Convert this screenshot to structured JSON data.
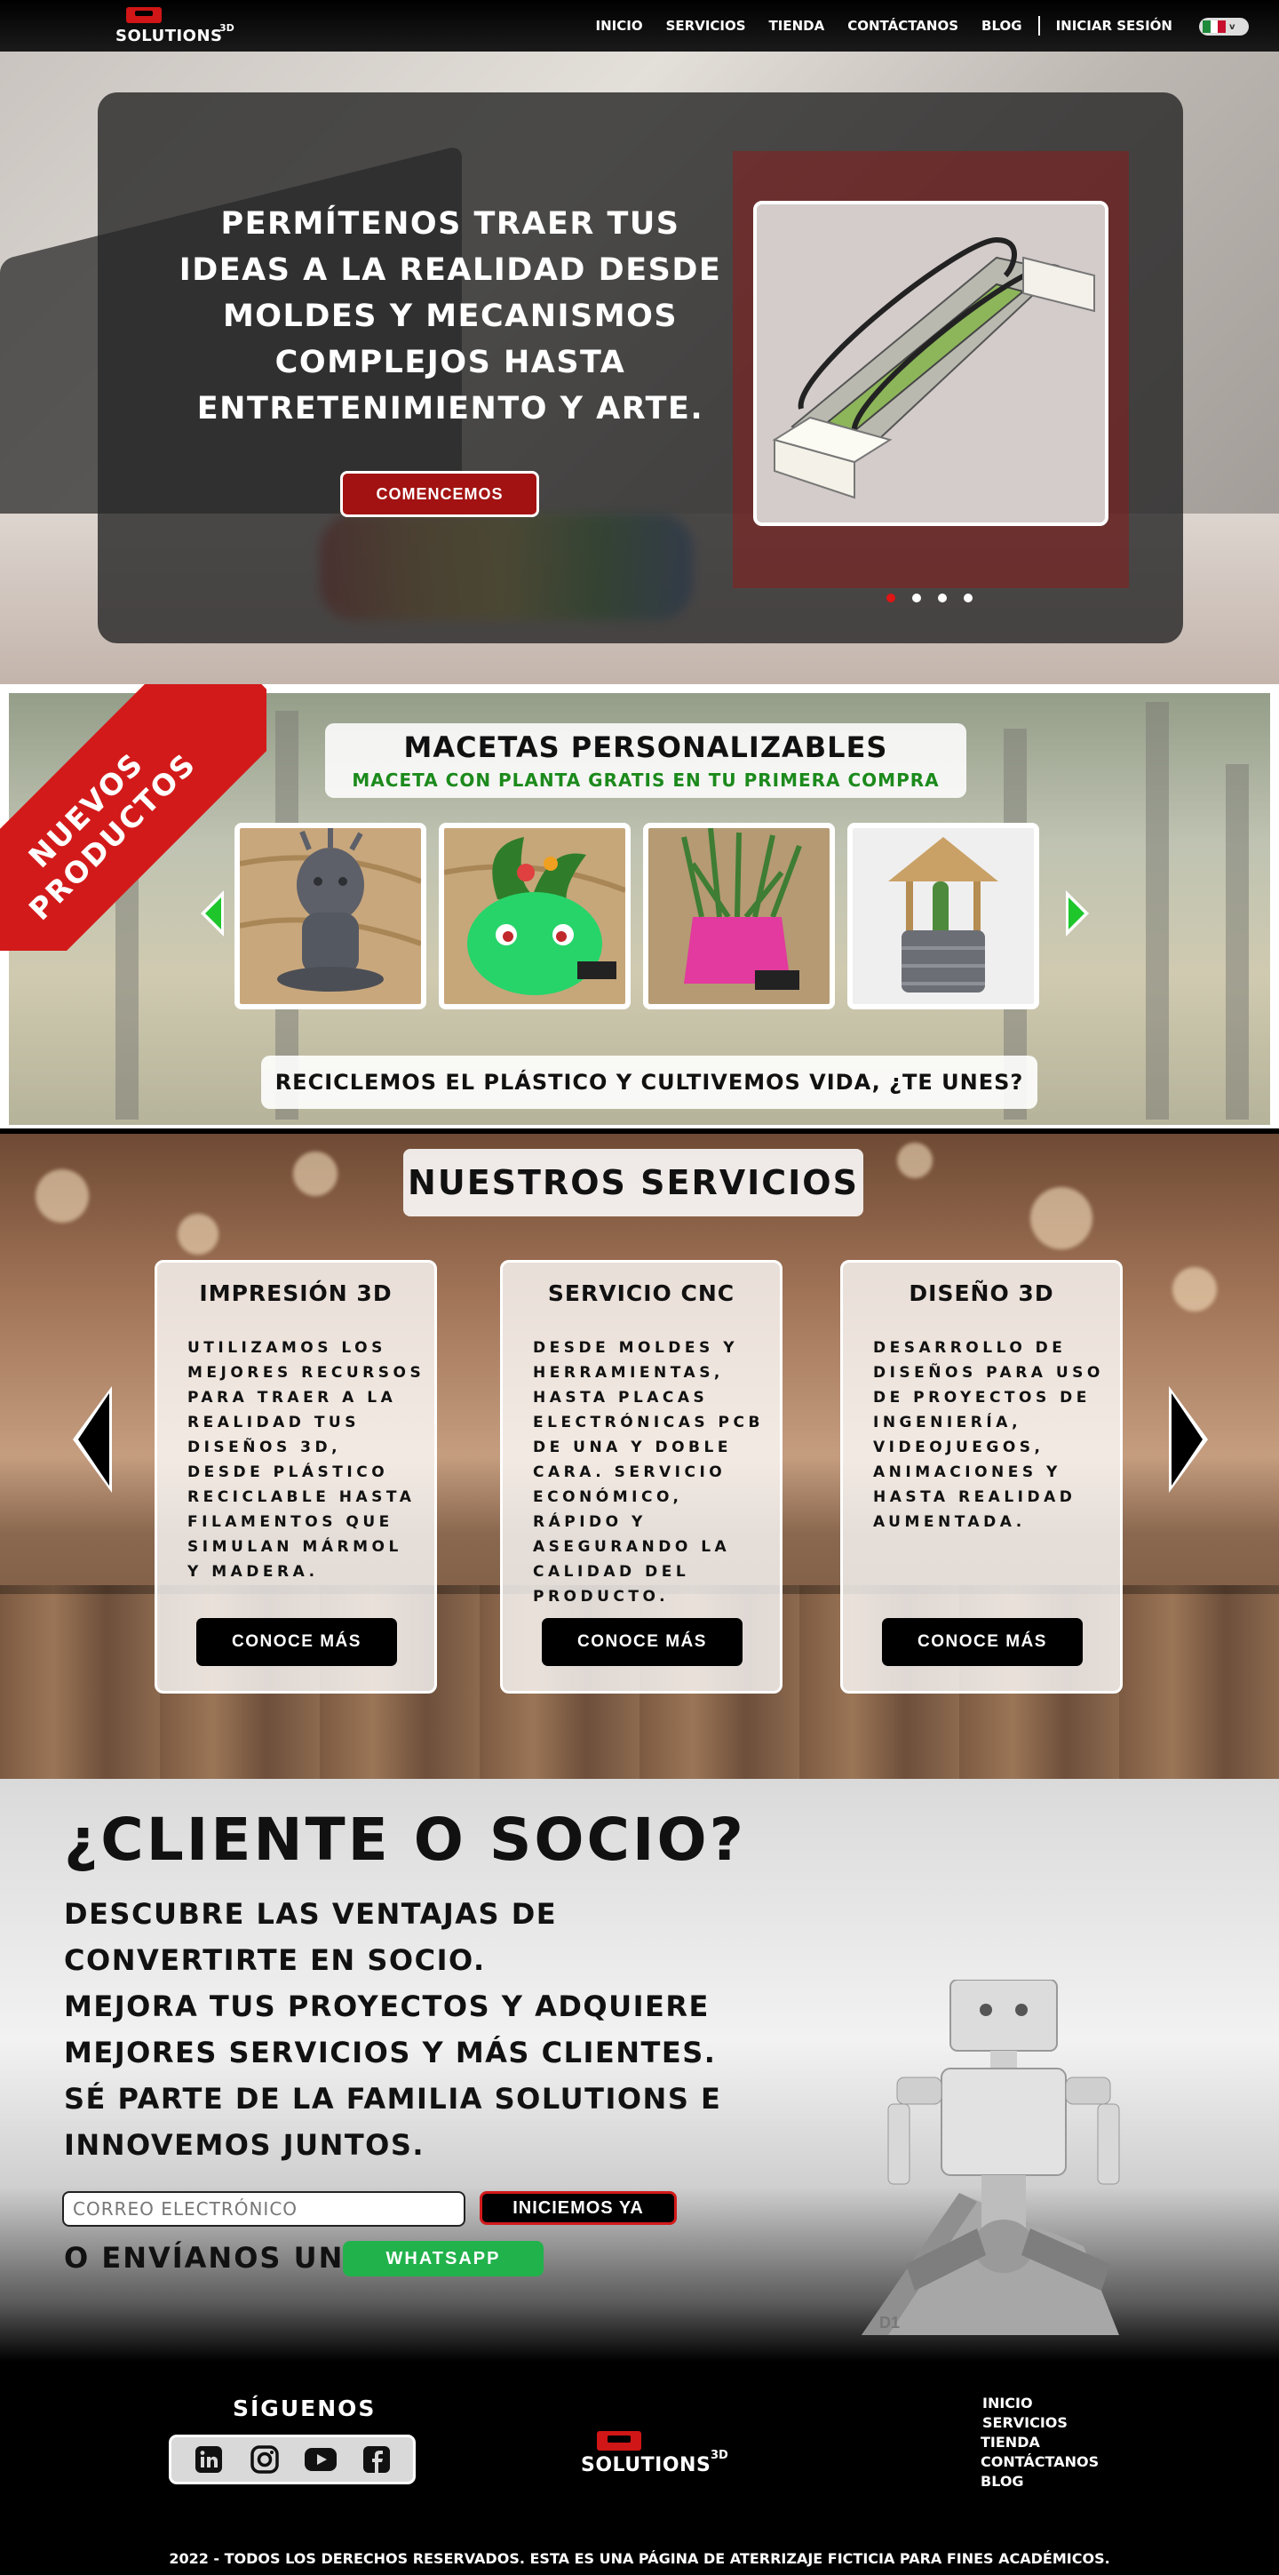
{
  "brand": {
    "name": "SOLUTIONS",
    "sup": "3D"
  },
  "nav": {
    "items": [
      {
        "label": "INICIO"
      },
      {
        "label": "SERVICIOS"
      },
      {
        "label": "TIENDA"
      },
      {
        "label": "CONTÁCTANOS"
      },
      {
        "label": "BLOG"
      }
    ],
    "login": "INICIAR SESIÓN",
    "language_flag": "mexico-flag-icon"
  },
  "hero": {
    "title": "PERMÍTENOS TRAER TUS IDEAS A LA REALIDAD DESDE MOLDES Y MECANISMOS COMPLEJOS HASTA ENTRETENIMIENTO Y ARTE.",
    "cta": "COMENCEMOS",
    "carousel_count": 4,
    "carousel_active": 1
  },
  "products": {
    "badge_line1": "NUEVOS",
    "badge_line2": "PRODUCTOS",
    "title": "MACETAS PERSONALIZABLES",
    "subtitle": "MACETA CON PLANTA GRATIS EN TU PRIMERA COMPRA",
    "items": [
      {
        "name": "groot-planter-image"
      },
      {
        "name": "bulbasaur-planter-image"
      },
      {
        "name": "pink-planter-image"
      },
      {
        "name": "well-planter-image"
      }
    ],
    "footer": "RECICLEMOS EL PLÁSTICO Y CULTIVEMOS VIDA, ¿TE UNES?"
  },
  "services": {
    "title": "NUESTROS SERVICIOS",
    "cards": [
      {
        "title": "IMPRESIÓN 3D",
        "text": "UTILIZAMOS LOS MEJORES RECURSOS PARA TRAER A LA REALIDAD TUS DISEÑOS 3D, DESDE PLÁSTICO RECICLABLE HASTA FILAMENTOS QUE SIMULAN MÁRMOL Y MADERA.",
        "button": "CONOCE MÁS"
      },
      {
        "title": "SERVICIO CNC",
        "text": "DESDE MOLDES Y HERRAMIENTAS, HASTA PLACAS ELECTRÓNICAS PCB DE UNA Y DOBLE CARA. SERVICIO ECONÓMICO, RÁPIDO Y ASEGURANDO LA CALIDAD DEL PRODUCTO.",
        "button": "CONOCE MÁS"
      },
      {
        "title": "DISEÑO 3D",
        "text": "DESARROLLO DE DISEÑOS PARA USO DE PROYECTOS DE INGENIERÍA, VIDEOJUEGOS, ANIMACIONES Y HASTA REALIDAD AUMENTADA.",
        "button": "CONOCE MÁS"
      }
    ]
  },
  "client": {
    "title": "¿CLIENTE O SOCIO?",
    "line1": "DESCUBRE LAS VENTAJAS DE CONVERTIRTE EN SOCIO.",
    "line2": "MEJORA TUS PROYECTOS Y ADQUIERE MEJORES SERVICIOS Y MÁS CLIENTES.",
    "line3": "SÉ PARTE DE LA FAMILIA SOLUTIONS E INNOVEMOS JUNTOS.",
    "email_placeholder": "CORREO ELECTRÓNICO",
    "submit": "INICIEMOS YA",
    "or_send": "O ENVÍANOS UN",
    "whatsapp": "WHATSAPP",
    "robot_label": "D1"
  },
  "footer": {
    "follow": "SÍGUENOS",
    "social": [
      "linkedin-icon",
      "instagram-icon",
      "youtube-icon",
      "facebook-icon"
    ],
    "links": [
      "INICIO",
      "SERVICIOS",
      "TIENDA",
      "CONTÁCTANOS",
      "BLOG"
    ],
    "copyright": "2022 - TODOS LOS DERECHOS RESERVADOS. ESTA ES UNA PÁGINA DE ATERRIZAJE FICTICIA PARA FINES ACADÉMICOS."
  },
  "colors": {
    "accent_red": "#d31a1a",
    "green": "#1ec62c",
    "whatsapp": "#22b24c"
  }
}
